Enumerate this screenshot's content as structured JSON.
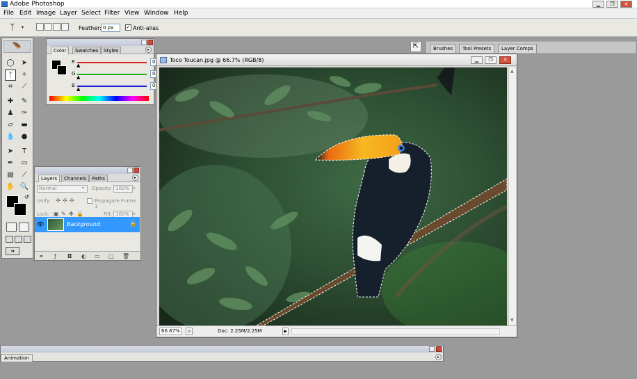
{
  "app": {
    "title": "Adobe Photoshop"
  },
  "menu": [
    "File",
    "Edit",
    "Image",
    "Layer",
    "Select",
    "Filter",
    "View",
    "Window",
    "Help"
  ],
  "options": {
    "feather_label": "Feather:",
    "feather_value": "0 px",
    "antialias_label": "Anti-alias",
    "antialias_checked": true
  },
  "well_tabs": [
    "Brushes",
    "Tool Presets",
    "Layer Comps"
  ],
  "color_panel": {
    "tabs": [
      "Color",
      "Swatches",
      "Styles"
    ],
    "active_tab": "Color",
    "channels": [
      {
        "label": "R",
        "value": "0",
        "color": "#e02020"
      },
      {
        "label": "G",
        "value": "0",
        "color": "#20b020"
      },
      {
        "label": "B",
        "value": "0",
        "color": "#2020e0"
      }
    ]
  },
  "layers_panel": {
    "tabs": [
      "Layers",
      "Channels",
      "Paths"
    ],
    "active_tab": "Layers",
    "blend_mode": "Normal",
    "opacity_label": "Opacity:",
    "opacity_value": "100%",
    "unify_label": "Unify:",
    "propagate_label": "Propagate Frame 1",
    "lock_label": "Lock:",
    "fill_label": "Fill:",
    "fill_value": "100%",
    "layers": [
      {
        "name": "Background",
        "selected": true,
        "locked": true
      }
    ]
  },
  "document": {
    "title": "Toco Toucan.jpg @ 66.7% (RGB/8)",
    "zoom": "66.67%",
    "info": "Doc: 2.25M/2.25M"
  },
  "animation_panel": {
    "tab": "Animation"
  },
  "colors": {
    "accent": "#3399ff",
    "workspace": "#9a9a9a"
  }
}
